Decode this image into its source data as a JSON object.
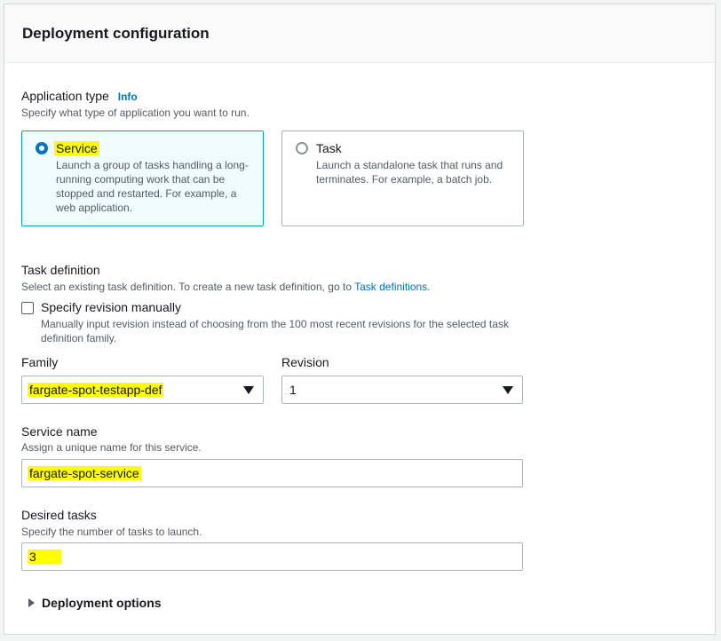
{
  "panel": {
    "title": "Deployment configuration"
  },
  "application_type": {
    "label": "Application type",
    "info_link": "Info",
    "description": "Specify what type of application you want to run.",
    "options": [
      {
        "title": "Service",
        "description": "Launch a group of tasks handling a long-running computing work that can be stopped and restarted. For example, a web application.",
        "selected": true
      },
      {
        "title": "Task",
        "description": "Launch a standalone task that runs and terminates. For example, a batch job.",
        "selected": false
      }
    ]
  },
  "task_definition": {
    "label": "Task definition",
    "description_prefix": "Select an existing task definition. To create a new task definition, go to ",
    "description_link": "Task definitions",
    "description_suffix": ".",
    "specify_revision": {
      "label": "Specify revision manually",
      "description": "Manually input revision instead of choosing from the 100 most recent revisions for the selected task definition family.",
      "checked": false
    },
    "family": {
      "label": "Family",
      "value": "fargate-spot-testapp-def"
    },
    "revision": {
      "label": "Revision",
      "value": "1"
    }
  },
  "service_name": {
    "label": "Service name",
    "description": "Assign a unique name for this service.",
    "value": "fargate-spot-service"
  },
  "desired_tasks": {
    "label": "Desired tasks",
    "description": "Specify the number of tasks to launch.",
    "value": "3"
  },
  "deployment_options": {
    "label": "Deployment options",
    "expanded": false
  },
  "colors": {
    "accent": "#0073bb",
    "selected_border": "#00a1c9",
    "highlight": "#ffff00"
  },
  "icons": {
    "radio_checked": "radio-checked-icon",
    "radio_unchecked": "radio-unchecked-icon",
    "dropdown": "caret-down-icon",
    "expander": "caret-right-icon"
  }
}
